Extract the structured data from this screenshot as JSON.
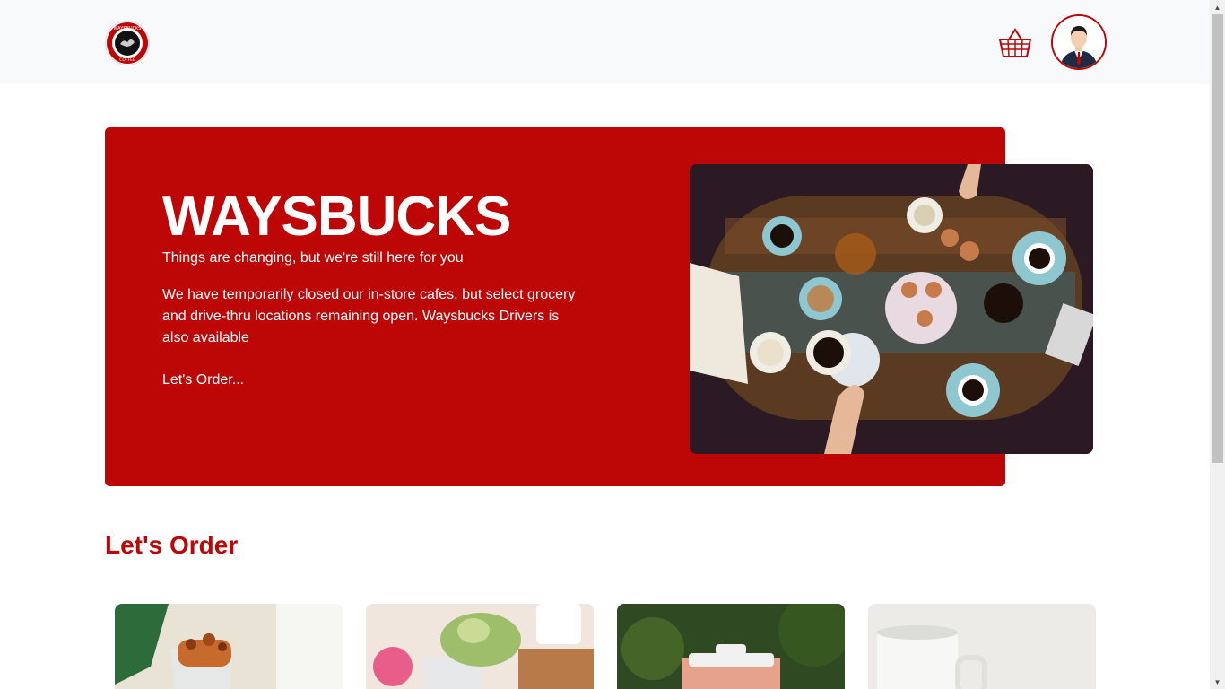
{
  "navbar": {
    "logo": {
      "name": "waysbucks-logo",
      "text_top": "WAYSBUCKS",
      "text_bottom": "COFFEE"
    },
    "cart_icon": "basket-icon",
    "avatar_icon": "user-avatar"
  },
  "hero": {
    "title": "WAYSBUCKS",
    "subtitle": "Things are changing, but we're still here for you",
    "description": "We have temporarily closed our in-store cafes, but select grocery and drive-thru locations remaining open. Waysbucks Drivers is also available",
    "cta": "Let's Order..."
  },
  "order_section": {
    "title": "Let's Order"
  },
  "colors": {
    "brand": "#bd0707",
    "navbar_bg": "#f8f9fa"
  }
}
